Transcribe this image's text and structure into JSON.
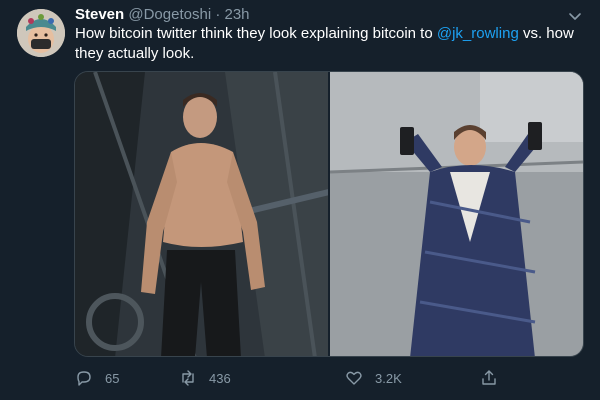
{
  "tweet": {
    "author_name": "Steven",
    "author_handle": "@Dogetoshi",
    "separator": "·",
    "time": "23h",
    "text_before": "How bitcoin twitter think they look explaining bitcoin to ",
    "mention": "@jk_rowling",
    "text_after": " vs. how they actually look.",
    "replies": "65",
    "retweets": "436",
    "likes": "3.2K"
  },
  "icons": {
    "caret": "chevron-down-icon",
    "reply": "reply-icon",
    "retweet": "retweet-icon",
    "like": "heart-icon",
    "share": "share-icon"
  },
  "colors": {
    "background": "#15202b",
    "secondary_text": "#8899a6",
    "link": "#1da1f2",
    "border": "#38444d"
  }
}
